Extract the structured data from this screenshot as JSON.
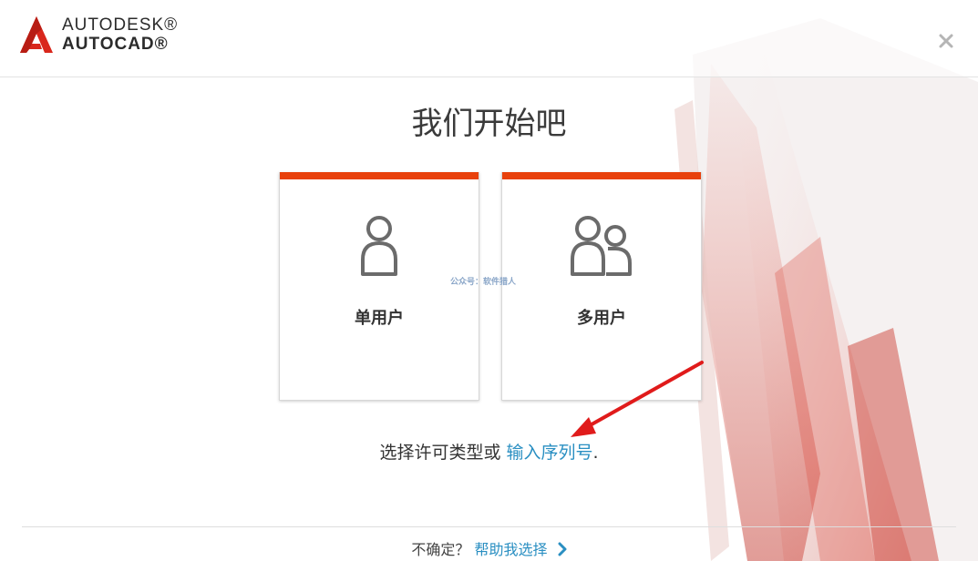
{
  "brand": {
    "line1": "AUTODESK®",
    "line2": "AUTOCAD®",
    "accent_color": "#e8410c",
    "logo_color": "#d9271c"
  },
  "window": {
    "close_icon": "close-icon"
  },
  "main": {
    "title": "我们开始吧",
    "cards": [
      {
        "label": "单用户",
        "icon": "single-user-icon"
      },
      {
        "label": "多用户",
        "icon": "multi-user-icon"
      }
    ],
    "watermark": "公众号：软件猎人",
    "prompt_text": "选择许可类型或 ",
    "prompt_link": "输入序列号",
    "prompt_end": ".",
    "link_color": "#2a8fc2"
  },
  "footer": {
    "question": "不确定？",
    "help_link": "帮助我选择",
    "chevron_icon": "chevron-right-icon"
  },
  "annotation": {
    "arrow_color": "#e01b1b"
  }
}
